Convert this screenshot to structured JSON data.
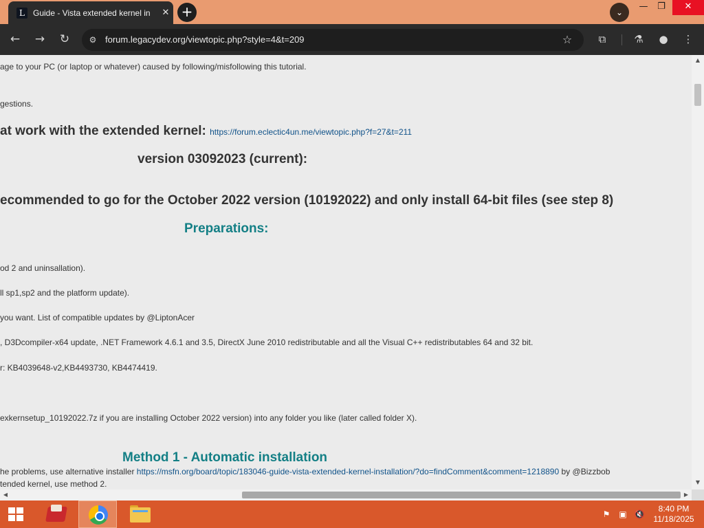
{
  "browser": {
    "tab": {
      "title": "Guide - Vista extended kernel in",
      "favicon_letter": "L"
    },
    "address": "forum.legacydev.org/viewtopic.php?style=4&t=209"
  },
  "content": {
    "line1": "age to your PC (or laptop or whatever) caused by following/misfollowing this tutorial.",
    "line2": "gestions.",
    "heading_work_text": "at work with the extended kernel:",
    "heading_work_link": "https://forum.eclectic4un.me/viewtopic.php?f=27&t=211",
    "heading_version": "version 03092023 (current):",
    "heading_recommend": "ecommended to go for the October 2022 version (10192022) and only install 64-bit files (see step 8)",
    "heading_preparations": "Preparations:",
    "prep_line1": "od 2 and uninsallation).",
    "prep_line2": "ll sp1,sp2 and the platform update).",
    "prep_line3": "you want. List of compatible updates by @LiptonAcer",
    "prep_line4": ", D3Dcompiler-x64 update, .NET Framework 4.6.1 and 3.5, DirectX June 2010 redistributable and all the Visual C++ redistributables 64 and 32 bit.",
    "prep_line5": "r: KB4039648-v2,KB4493730, KB4474419.",
    "prep_line6": "exkernsetup_10192022.7z if you are installing October 2022 version) into any folder you like (later called folder X).",
    "heading_method1": "Method 1 - Automatic installation",
    "method_line1_text": "he problems, use alternative installer",
    "method_line1_link": "https://msfn.org/board/topic/183046-guide-vista-extended-kernel-installation/?do=findComment&comment=1218890",
    "method_line1_by": "by @Bizzbob",
    "method_line2": "tended kernel, use method 2."
  },
  "taskbar": {
    "clock_time": "8:40 PM",
    "clock_date": "11/18/2025"
  },
  "colors": {
    "titlebar": "#e99b70",
    "toolbar": "#2b2b2b",
    "page_bg": "#ebebeb",
    "heading_teal": "#137f85",
    "link": "#105289",
    "taskbar": "#d9582b"
  }
}
